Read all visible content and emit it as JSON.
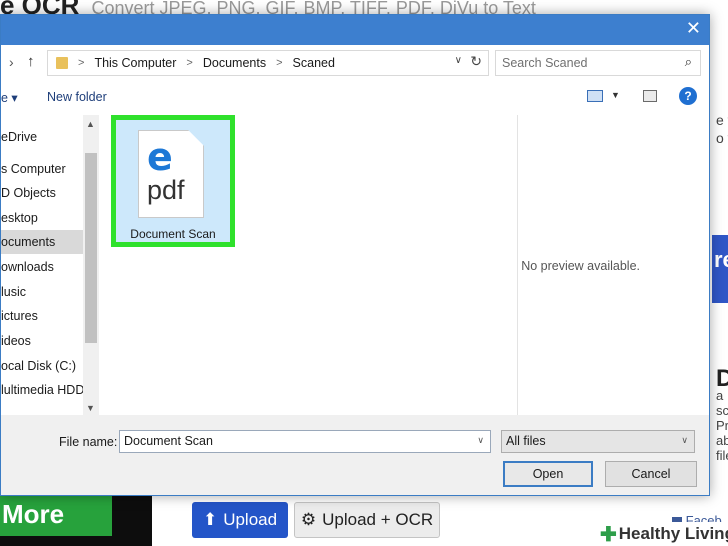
{
  "background": {
    "title_big": "e OCR",
    "title_sub": "Convert JPEG, PNG, GIF, BMP, TIFF, PDF, DjVu to Text",
    "right_snippets": [
      "e th",
      "o y"
    ],
    "right_blue_text": "re",
    "right_bold_text": "D",
    "right_small": [
      "a",
      "sc",
      "Pr",
      "ab",
      "file"
    ],
    "more_label": "More",
    "upload_label": "Upload",
    "upload_ocr_label": "Upload + OCR",
    "facebook_label": "Faceb",
    "watermark": "Healthy Living"
  },
  "dialog": {
    "breadcrumb": [
      "This Computer",
      "Documents",
      "Scaned"
    ],
    "search_placeholder": "Search Scaned",
    "organize_label": "e ▾",
    "new_folder_label": "New folder",
    "nav_items": [
      {
        "label": "eDrive",
        "selected": false
      },
      {
        "label": "s Computer",
        "selected": false
      },
      {
        "label": "D Objects",
        "selected": false
      },
      {
        "label": "esktop",
        "selected": false
      },
      {
        "label": "ocuments",
        "selected": true
      },
      {
        "label": "ownloads",
        "selected": false
      },
      {
        "label": "lusic",
        "selected": false
      },
      {
        "label": "ictures",
        "selected": false
      },
      {
        "label": "ideos",
        "selected": false
      },
      {
        "label": "ocal Disk (C:)",
        "selected": false
      },
      {
        "label": "lultimedia HDD",
        "selected": false
      }
    ],
    "file": {
      "name": "Document Scan",
      "icon_letter": "e",
      "icon_type": "pdf"
    },
    "no_preview": "No preview available.",
    "file_name_label": "File name:",
    "file_name_value": "Document Scan",
    "file_type_value": "All files",
    "open_label": "Open",
    "cancel_label": "Cancel"
  },
  "colors": {
    "titlebar": "#3d7fcf",
    "highlight": "#2fe12c",
    "selected_file_bg": "#cde8fb",
    "upload_button": "#2455c8",
    "more_button": "#27a23c"
  }
}
